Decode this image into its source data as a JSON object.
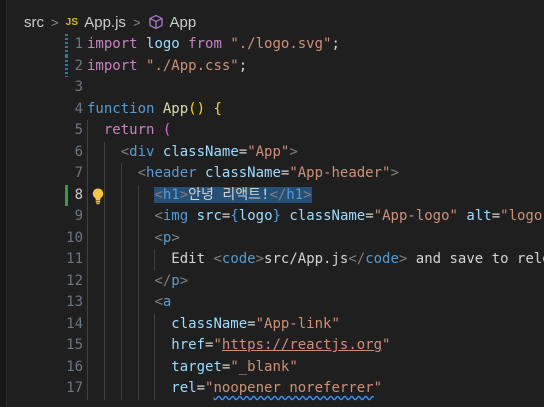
{
  "breadcrumb": {
    "folder": "src",
    "file": "App.js",
    "file_badge": "JS",
    "symbol": "App",
    "separator": ">"
  },
  "editor": {
    "active_line": 8,
    "lines": [
      {
        "n": "1",
        "parts": [
          [
            "kw",
            "import"
          ],
          [
            "plain",
            " "
          ],
          [
            "var",
            "logo"
          ],
          [
            "plain",
            " "
          ],
          [
            "kw",
            "from"
          ],
          [
            "plain",
            " "
          ],
          [
            "str",
            "\"./logo.svg\""
          ],
          [
            "plain",
            ";"
          ]
        ]
      },
      {
        "n": "2",
        "parts": [
          [
            "kw",
            "import"
          ],
          [
            "plain",
            " "
          ],
          [
            "str",
            "\"./App.css\""
          ],
          [
            "plain",
            ";"
          ]
        ]
      },
      {
        "n": "3",
        "parts": []
      },
      {
        "n": "4",
        "parts": [
          [
            "kw2",
            "function"
          ],
          [
            "plain",
            " "
          ],
          [
            "fn",
            "App"
          ],
          [
            "brace-gold",
            "()"
          ],
          [
            "plain",
            " "
          ],
          [
            "brace-gold",
            "{"
          ]
        ]
      },
      {
        "n": "5",
        "parts": [
          [
            "plain",
            "  "
          ],
          [
            "kw",
            "return"
          ],
          [
            "plain",
            " "
          ],
          [
            "brace",
            "("
          ]
        ]
      },
      {
        "n": "6",
        "parts": [
          [
            "plain",
            "    "
          ],
          [
            "punc",
            "<"
          ],
          [
            "tag",
            "div"
          ],
          [
            "plain",
            " "
          ],
          [
            "attr",
            "className"
          ],
          [
            "plain",
            "="
          ],
          [
            "str",
            "\"App\""
          ],
          [
            "punc",
            ">"
          ]
        ]
      },
      {
        "n": "7",
        "parts": [
          [
            "plain",
            "      "
          ],
          [
            "punc",
            "<"
          ],
          [
            "tag",
            "header"
          ],
          [
            "plain",
            " "
          ],
          [
            "attr",
            "className"
          ],
          [
            "plain",
            "="
          ],
          [
            "str",
            "\"App-header\""
          ],
          [
            "punc",
            ">"
          ]
        ]
      },
      {
        "n": "8",
        "parts": [
          [
            "plain",
            "        "
          ],
          [
            "sel:punc",
            "<"
          ],
          [
            "sel:tag",
            "h1"
          ],
          [
            "sel:punc",
            ">"
          ],
          [
            "sel:plain",
            "안녕 리액트!"
          ],
          [
            "sel:punc",
            "</"
          ],
          [
            "sel:tag",
            "h1"
          ],
          [
            "sel:punc",
            ">"
          ]
        ]
      },
      {
        "n": "9",
        "parts": [
          [
            "plain",
            "        "
          ],
          [
            "punc",
            "<"
          ],
          [
            "tag",
            "img"
          ],
          [
            "plain",
            " "
          ],
          [
            "attr",
            "src"
          ],
          [
            "plain",
            "="
          ],
          [
            "kw2",
            "{"
          ],
          [
            "var",
            "logo"
          ],
          [
            "kw2",
            "}"
          ],
          [
            "plain",
            " "
          ],
          [
            "attr",
            "className"
          ],
          [
            "plain",
            "="
          ],
          [
            "str",
            "\"App-logo\""
          ],
          [
            "plain",
            " "
          ],
          [
            "attr",
            "alt"
          ],
          [
            "plain",
            "="
          ],
          [
            "str",
            "\"logo\""
          ]
        ]
      },
      {
        "n": "10",
        "parts": [
          [
            "plain",
            "        "
          ],
          [
            "punc",
            "<"
          ],
          [
            "tag",
            "p"
          ],
          [
            "punc",
            ">"
          ]
        ]
      },
      {
        "n": "11",
        "parts": [
          [
            "plain",
            "          "
          ],
          [
            "plain",
            "Edit "
          ],
          [
            "punc",
            "<"
          ],
          [
            "tag",
            "code"
          ],
          [
            "punc",
            ">"
          ],
          [
            "plain",
            "src/App.js"
          ],
          [
            "punc",
            "</"
          ],
          [
            "tag",
            "code"
          ],
          [
            "punc",
            ">"
          ],
          [
            "plain",
            " and save to reload."
          ]
        ]
      },
      {
        "n": "12",
        "parts": [
          [
            "plain",
            "        "
          ],
          [
            "punc",
            "</"
          ],
          [
            "tag",
            "p"
          ],
          [
            "punc",
            ">"
          ]
        ]
      },
      {
        "n": "13",
        "parts": [
          [
            "plain",
            "        "
          ],
          [
            "punc",
            "<"
          ],
          [
            "tag",
            "a"
          ]
        ]
      },
      {
        "n": "14",
        "parts": [
          [
            "plain",
            "          "
          ],
          [
            "attr",
            "className"
          ],
          [
            "plain",
            "="
          ],
          [
            "str",
            "\"App-link\""
          ]
        ]
      },
      {
        "n": "15",
        "parts": [
          [
            "plain",
            "          "
          ],
          [
            "attr",
            "href"
          ],
          [
            "plain",
            "="
          ],
          [
            "str",
            "\""
          ],
          [
            "url:str",
            "https://reactjs.org"
          ],
          [
            "str",
            "\""
          ]
        ]
      },
      {
        "n": "16",
        "parts": [
          [
            "plain",
            "          "
          ],
          [
            "attr",
            "target"
          ],
          [
            "plain",
            "="
          ],
          [
            "str",
            "\"_blank\""
          ]
        ]
      },
      {
        "n": "17",
        "parts": [
          [
            "plain",
            "          "
          ],
          [
            "attr",
            "rel"
          ],
          [
            "plain",
            "="
          ],
          [
            "str",
            "\""
          ],
          [
            "squiggle:str",
            "noopener noreferrer"
          ],
          [
            "str",
            "\""
          ]
        ]
      }
    ]
  },
  "colors": {
    "background": "#1f1f1f",
    "selection": "#264f78",
    "gutter_added": "#2ea043",
    "gutter_modified": "#1b81a8"
  }
}
